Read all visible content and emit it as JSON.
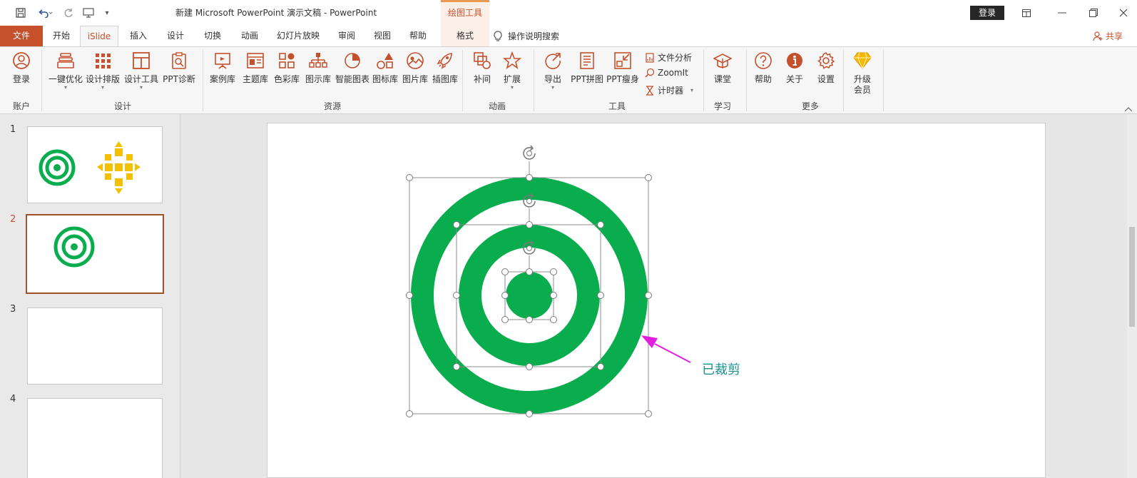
{
  "titlebar": {
    "doc_title": "新建 Microsoft PowerPoint 演示文稿  -  PowerPoint",
    "context_group": "绘图工具",
    "login_label": "登录"
  },
  "tabs": {
    "file": "文件",
    "home": "开始",
    "islide": "iSlide",
    "insert": "插入",
    "design": "设计",
    "transition": "切换",
    "animation": "动画",
    "slideshow": "幻灯片放映",
    "review": "审阅",
    "view": "视图",
    "help": "帮助",
    "format": "格式",
    "search": "操作说明搜索",
    "share": "共享"
  },
  "ribbon": {
    "account": {
      "label": "账户",
      "login": "登录"
    },
    "design": {
      "label": "设计",
      "one_click": "一键优化",
      "layout": "设计排版",
      "tools": "设计工具",
      "diagnose": "PPT诊断"
    },
    "resources": {
      "label": "资源",
      "cases": "案例库",
      "themes": "主题库",
      "colors": "色彩库",
      "diagrams": "图示库",
      "smart_charts": "智能图表",
      "icons": "图标库",
      "pictures": "图片库",
      "illustrations": "插图库"
    },
    "animation": {
      "label": "动画",
      "tween": "补间",
      "extend": "扩展"
    },
    "tools": {
      "label": "工具",
      "export": "导出",
      "collage": "PPT拼图",
      "slim": "PPT瘦身",
      "file_analysis": "文件分析",
      "zoomit": "ZoomIt",
      "timer": "计时器"
    },
    "learn": {
      "label": "学习",
      "classroom": "课堂"
    },
    "more": {
      "label": "更多",
      "help": "帮助",
      "about": "关于",
      "settings": "设置",
      "upgrade_line1": "升级",
      "upgrade_line2": "会员"
    }
  },
  "slides": [
    {
      "number": "1"
    },
    {
      "number": "2"
    },
    {
      "number": "3"
    },
    {
      "number": "4"
    }
  ],
  "canvas": {
    "annotation": "已裁剪"
  },
  "colors": {
    "accent": "#c5502c",
    "ring_green": "#0aad4e",
    "dot_yellow": "#f5c000",
    "arrow_magenta": "#e21ee0",
    "label_teal": "#1a8f8f"
  }
}
